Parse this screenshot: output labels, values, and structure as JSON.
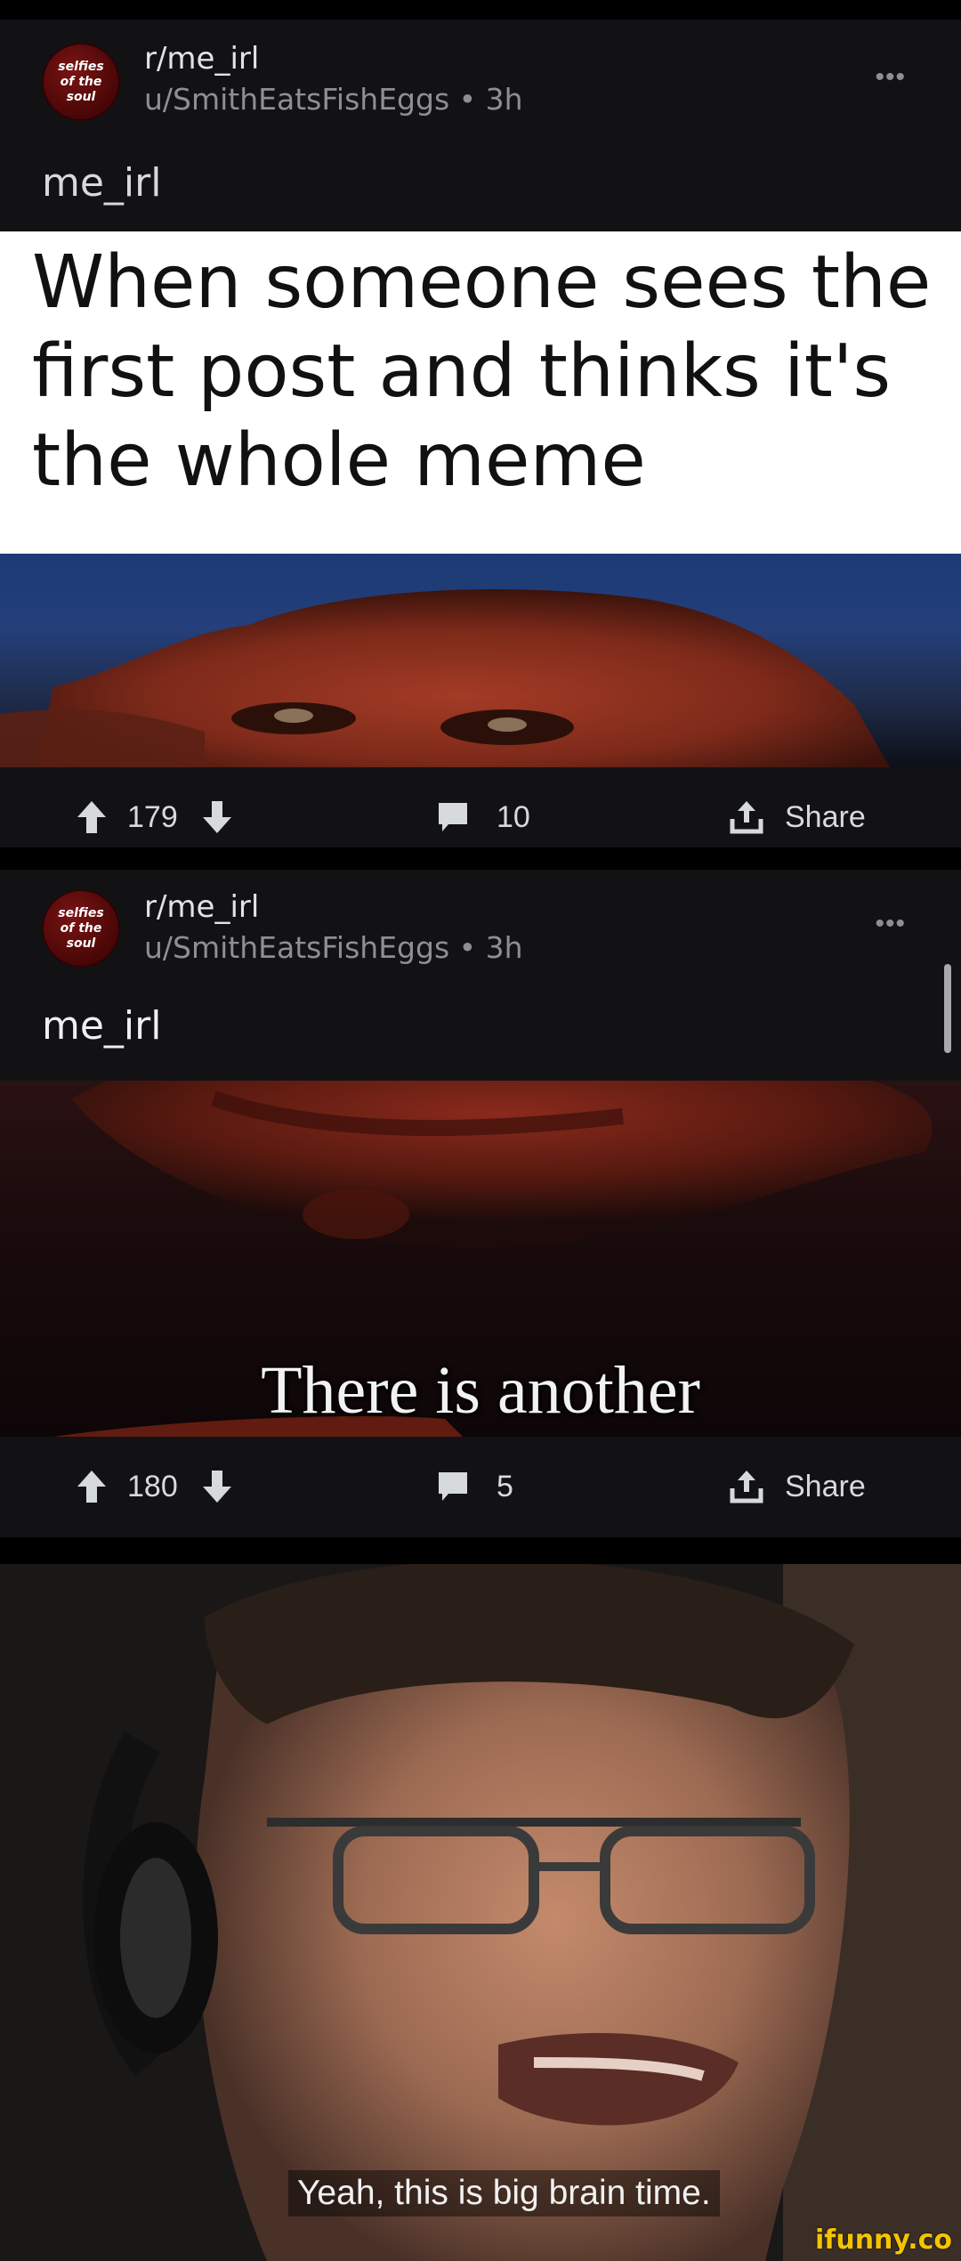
{
  "posts": [
    {
      "avatar": {
        "line1": "selfies",
        "line2": "of the",
        "line3": "soul"
      },
      "subreddit": "r/me_irl",
      "byline": "u/SmithEatsFishEggs • 3h",
      "overflow": "•••",
      "title": "me_irl",
      "caption": "When someone sees the first post and thinks it's the whole meme",
      "upvotes": "179",
      "comments": "10",
      "share": "Share"
    },
    {
      "avatar": {
        "line1": "selfies",
        "line2": "of the",
        "line3": "soul"
      },
      "subreddit": "r/me_irl",
      "byline": "u/SmithEatsFishEggs • 3h",
      "overflow": "•••",
      "title": "me_irl",
      "meme_text": "There is another",
      "upvotes": "180",
      "comments": "5",
      "share": "Share"
    }
  ],
  "final_meme": {
    "caption": "Yeah, this is big brain time."
  },
  "watermark": "ifunny.co",
  "icons": [
    "upvote-arrow-icon",
    "downvote-arrow-icon",
    "comment-bubble-icon",
    "share-upload-icon",
    "overflow-dots-icon"
  ],
  "colors": {
    "background": "#000000",
    "card": "#121215",
    "text": "#d7dadc",
    "muted": "#8d8f93",
    "watermark": "#f5c400"
  }
}
